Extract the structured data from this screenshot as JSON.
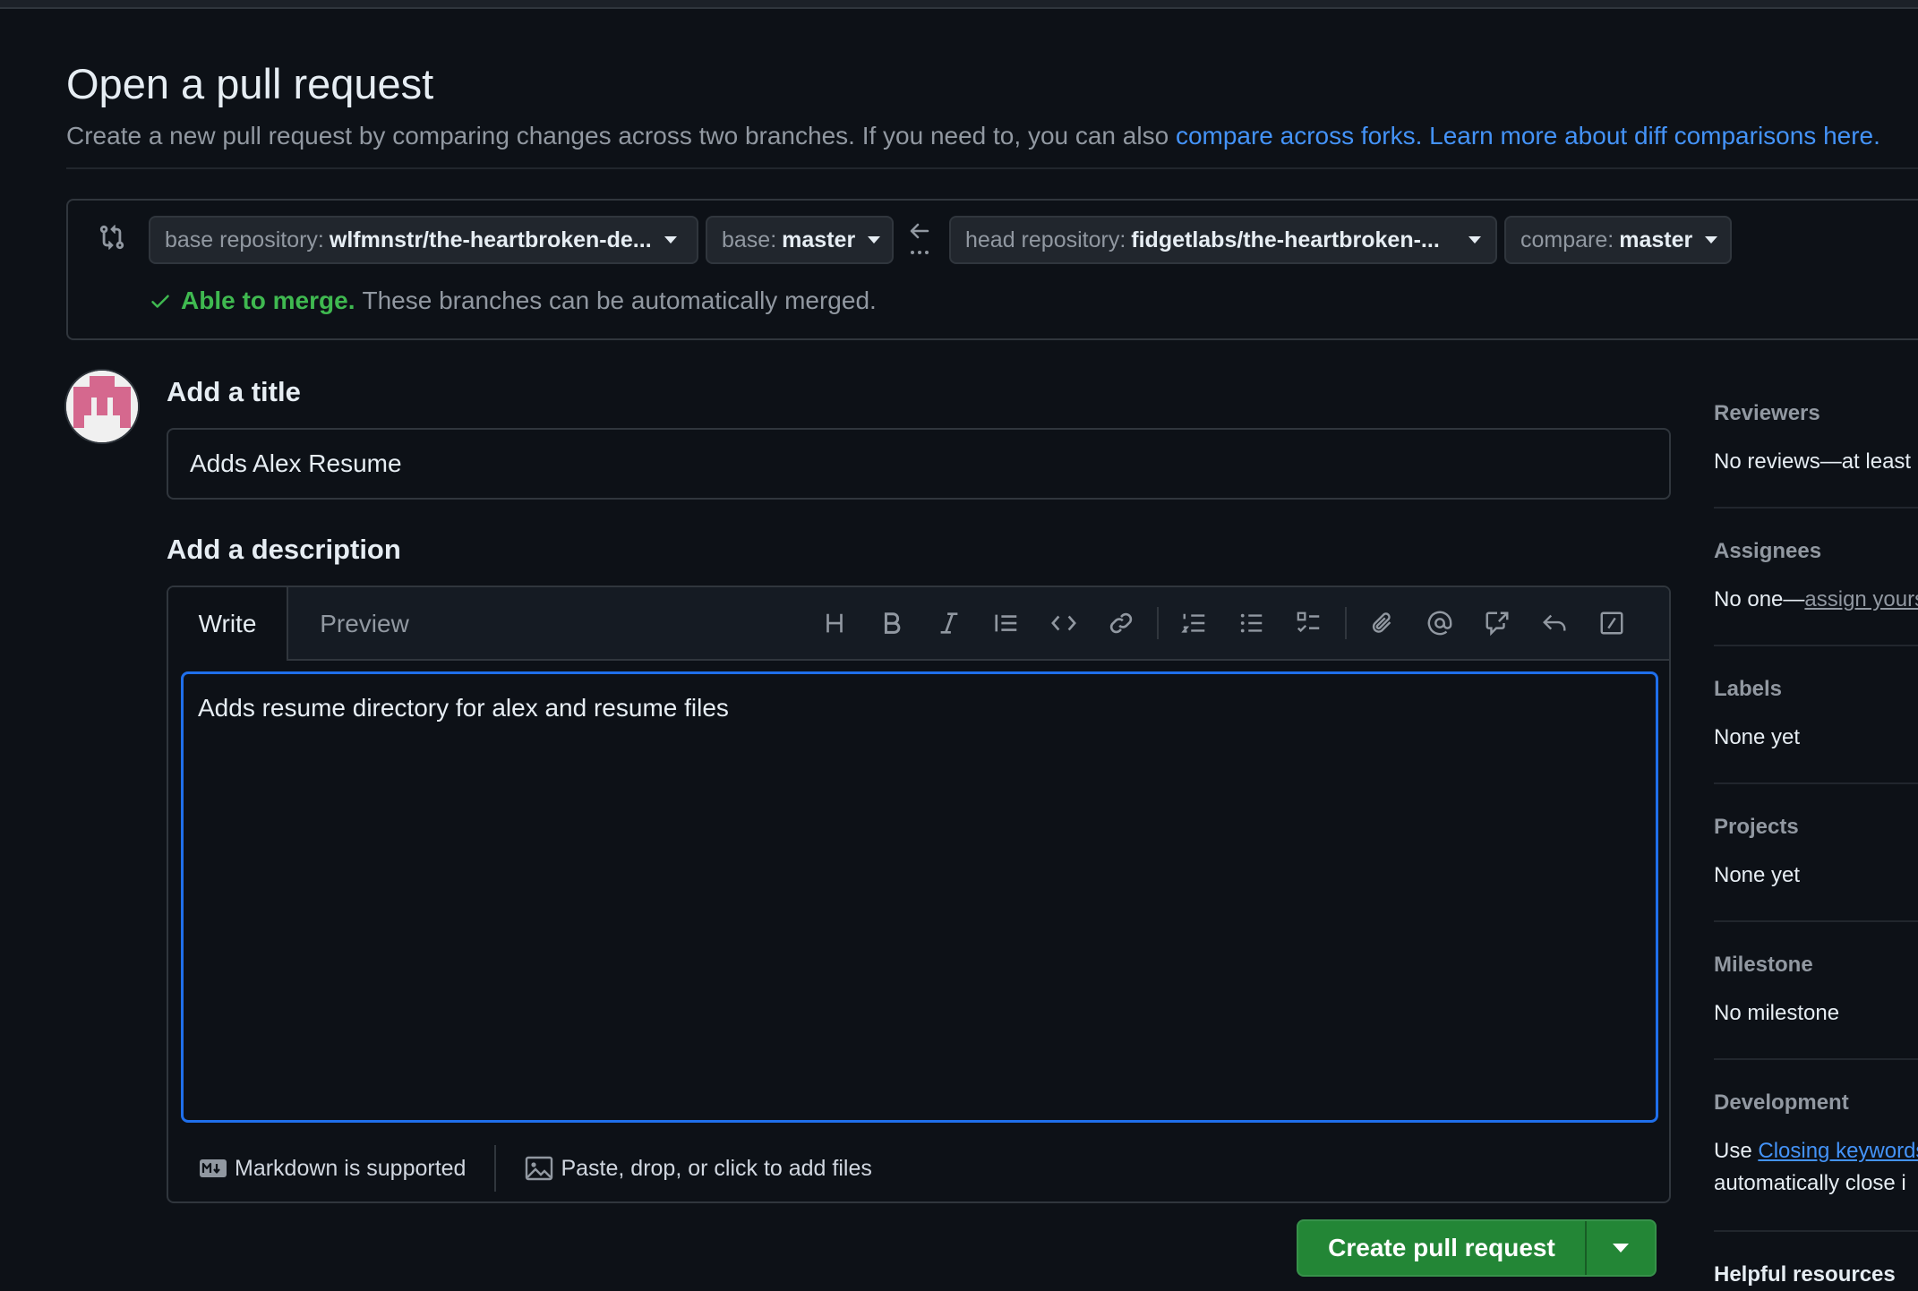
{
  "page": {
    "title": "Open a pull request",
    "subtitle_prefix": "Create a new pull request by comparing changes across two branches. If you need to, you can also ",
    "compare_forks_link": "compare across forks.",
    "learn_more_link": "Learn more about diff comparisons here."
  },
  "compare": {
    "base_repo_label": "base repository:",
    "base_repo_value": "wlfmnstr/the-heartbroken-de...",
    "base_label": "base:",
    "base_value": "master",
    "head_repo_label": "head repository:",
    "head_repo_value": "fidgetlabs/the-heartbroken-...",
    "compare_label": "compare:",
    "compare_value": "master",
    "merge_ok": "Able to merge.",
    "merge_msg": "These branches can be automatically merged."
  },
  "form": {
    "title_heading": "Add a title",
    "title_value": "Adds Alex Resume",
    "desc_heading": "Add a description",
    "tab_write": "Write",
    "tab_preview": "Preview",
    "description_value": "Adds resume directory for alex and resume files",
    "markdown_note": "Markdown is supported",
    "attach_note": "Paste, drop, or click to add files",
    "create_button": "Create pull request"
  },
  "sidebar": {
    "reviewers_h": "Reviewers",
    "reviewers_v": "No reviews—at least",
    "assignees_h": "Assignees",
    "assignees_prefix": "No one—",
    "assignees_link": "assign yours",
    "labels_h": "Labels",
    "labels_v": "None yet",
    "projects_h": "Projects",
    "projects_v": "None yet",
    "milestone_h": "Milestone",
    "milestone_v": "No milestone",
    "development_h": "Development",
    "development_prefix": "Use ",
    "development_link": "Closing keywords",
    "development_line2": "automatically close i",
    "helpful_h": "Helpful resources"
  },
  "colors": {
    "background": "#0d1117",
    "accent_link": "#4493f8",
    "success": "#3fb950",
    "primary_button": "#238636",
    "focus_border": "#1f6feb"
  }
}
